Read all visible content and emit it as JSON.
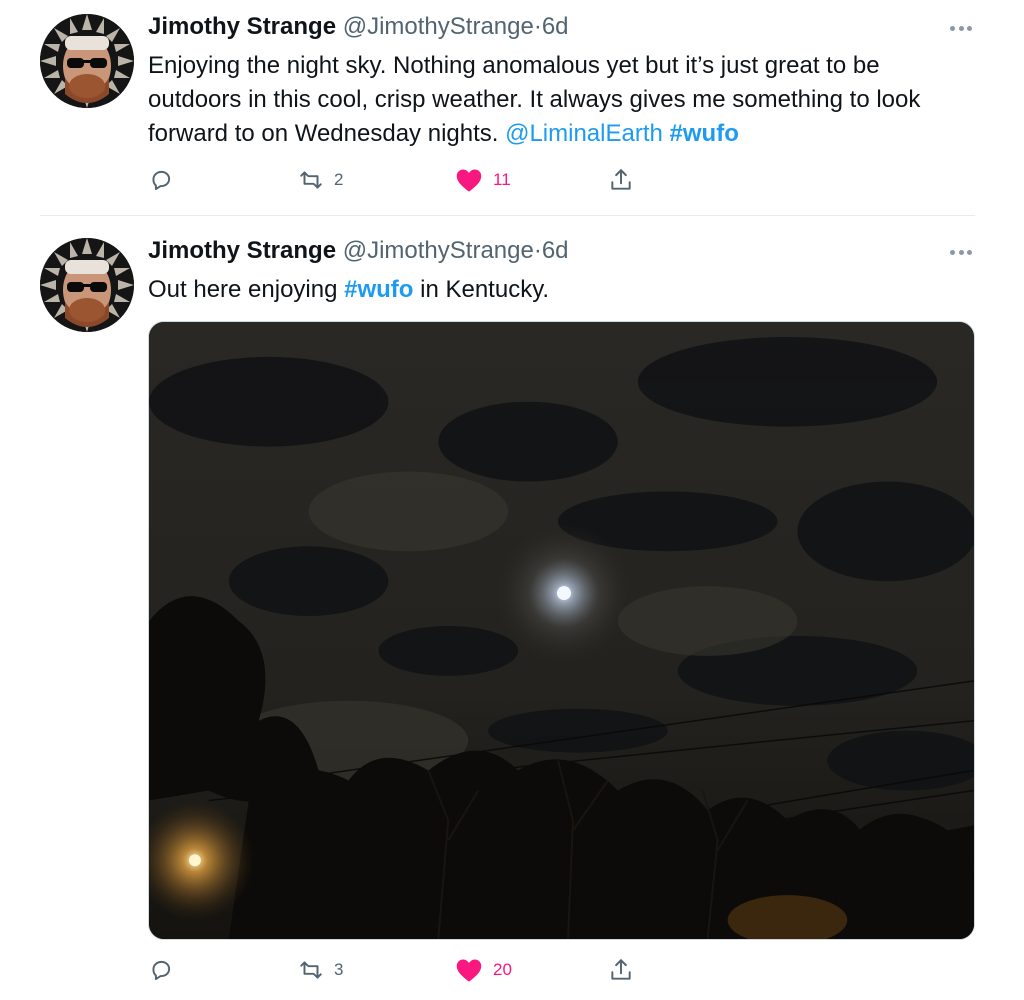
{
  "tweets": [
    {
      "author_name": "Jimothy Strange",
      "handle": "@JimothyStrange",
      "separator": "·",
      "time": "6d",
      "text_plain": "Enjoying the night sky. Nothing anomalous yet but it’s just great to be outdoors in this cool, crisp weather. It always gives me something to look forward to on Wednesday nights. ",
      "mention": "@LiminalEarth",
      "hashtag": "#wufo",
      "retweets": "2",
      "likes": "11",
      "liked": true
    },
    {
      "author_name": "Jimothy Strange",
      "handle": "@JimothyStrange",
      "separator": "·",
      "time": "6d",
      "text_before": "Out here enjoying ",
      "hashtag": "#wufo",
      "text_after": " in Kentucky.",
      "retweets": "3",
      "likes": "20",
      "liked": true,
      "media": "night-sky-photo"
    }
  ],
  "icons": {
    "reply": "reply-icon",
    "retweet": "retweet-icon",
    "like": "heart-icon",
    "share": "share-icon",
    "more": "more-icon"
  },
  "colors": {
    "link": "#1d9bf0",
    "like": "#f91880",
    "secondary_text": "#536471",
    "divider": "#e6ecf0"
  }
}
